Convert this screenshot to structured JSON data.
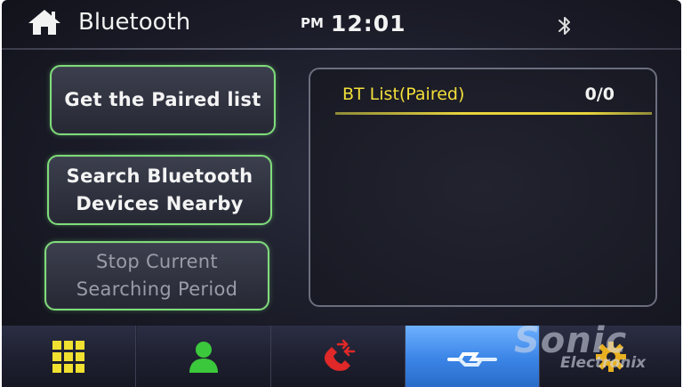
{
  "header": {
    "title": "Bluetooth",
    "ampm": "PM",
    "time": "12:01"
  },
  "buttons": {
    "paired": "Get the Paired list",
    "search": "Search Bluetooth\nDevices Nearby",
    "stop": "Stop Current\nSearching Period"
  },
  "list": {
    "title": "BT List(Paired)",
    "count": "0/0"
  },
  "nav": {
    "tabs": [
      {
        "icon": "grid-icon",
        "color": "#f0e030"
      },
      {
        "icon": "contact-icon",
        "color": "#3cc83c"
      },
      {
        "icon": "call-log-icon",
        "color": "#e02828"
      },
      {
        "icon": "bluetooth-link-icon",
        "color": "#ffffff",
        "active": true
      },
      {
        "icon": "gear-icon",
        "color": "#e8b020"
      }
    ]
  },
  "watermark": {
    "brand": "Sonic",
    "sub": "Electronix"
  },
  "colors": {
    "accent_green": "#7fdc7a",
    "list_title": "#f3df3a",
    "active_tab": "#3a84e6"
  }
}
